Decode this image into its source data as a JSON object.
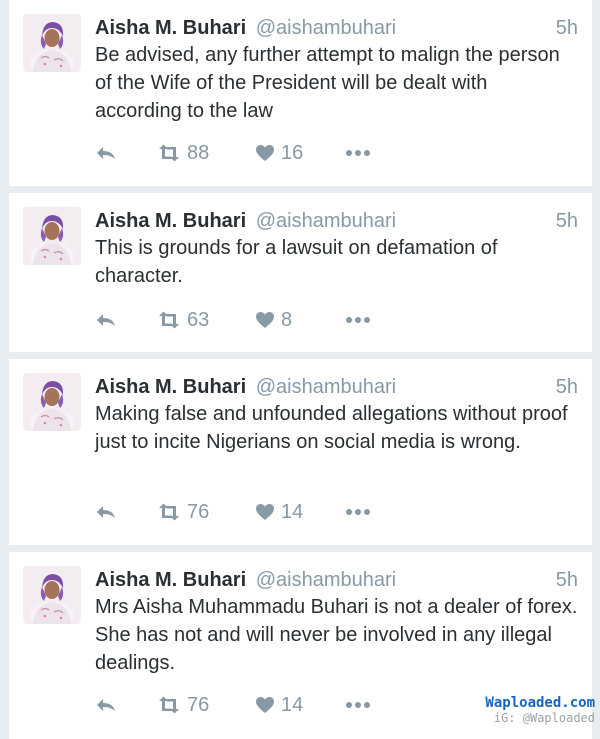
{
  "colors": {
    "background": "#e6ecf0",
    "card": "#ffffff",
    "name": "#292f33",
    "muted": "#8899a6",
    "watermark": "#1565c0",
    "avatar_headwrap": "#7b4fa8"
  },
  "icons": {
    "reply": "reply-arrow-icon",
    "retweet": "retweet-icon",
    "like": "heart-icon",
    "more": "more-dots-icon",
    "avatar": "avatar-photo"
  },
  "tweets": [
    {
      "name": "Aisha M. Buhari",
      "handle": "@aishambuhari",
      "time": "5h",
      "text": "Be advised, any further attempt to malign the person of the Wife of the President will be dealt with according to the law",
      "retweets": "88",
      "likes": "16"
    },
    {
      "name": "Aisha M. Buhari",
      "handle": "@aishambuhari",
      "time": "5h",
      "text": "This is grounds for a lawsuit on defamation of character.",
      "retweets": "63",
      "likes": "8"
    },
    {
      "name": "Aisha M. Buhari",
      "handle": "@aishambuhari",
      "time": "5h",
      "text": "Making false and unfounded allegations without proof just to incite Nigerians on social media is wrong.",
      "retweets": "76",
      "likes": "14"
    },
    {
      "name": "Aisha M. Buhari",
      "handle": "@aishambuhari",
      "time": "5h",
      "text": "Mrs Aisha Muhammadu Buhari is not a dealer of forex. She has not and will never be involved in any illegal dealings.",
      "retweets": "76",
      "likes": "14"
    }
  ],
  "watermark": {
    "site": "Waploaded.com",
    "ig": "iG: @Waploaded"
  }
}
